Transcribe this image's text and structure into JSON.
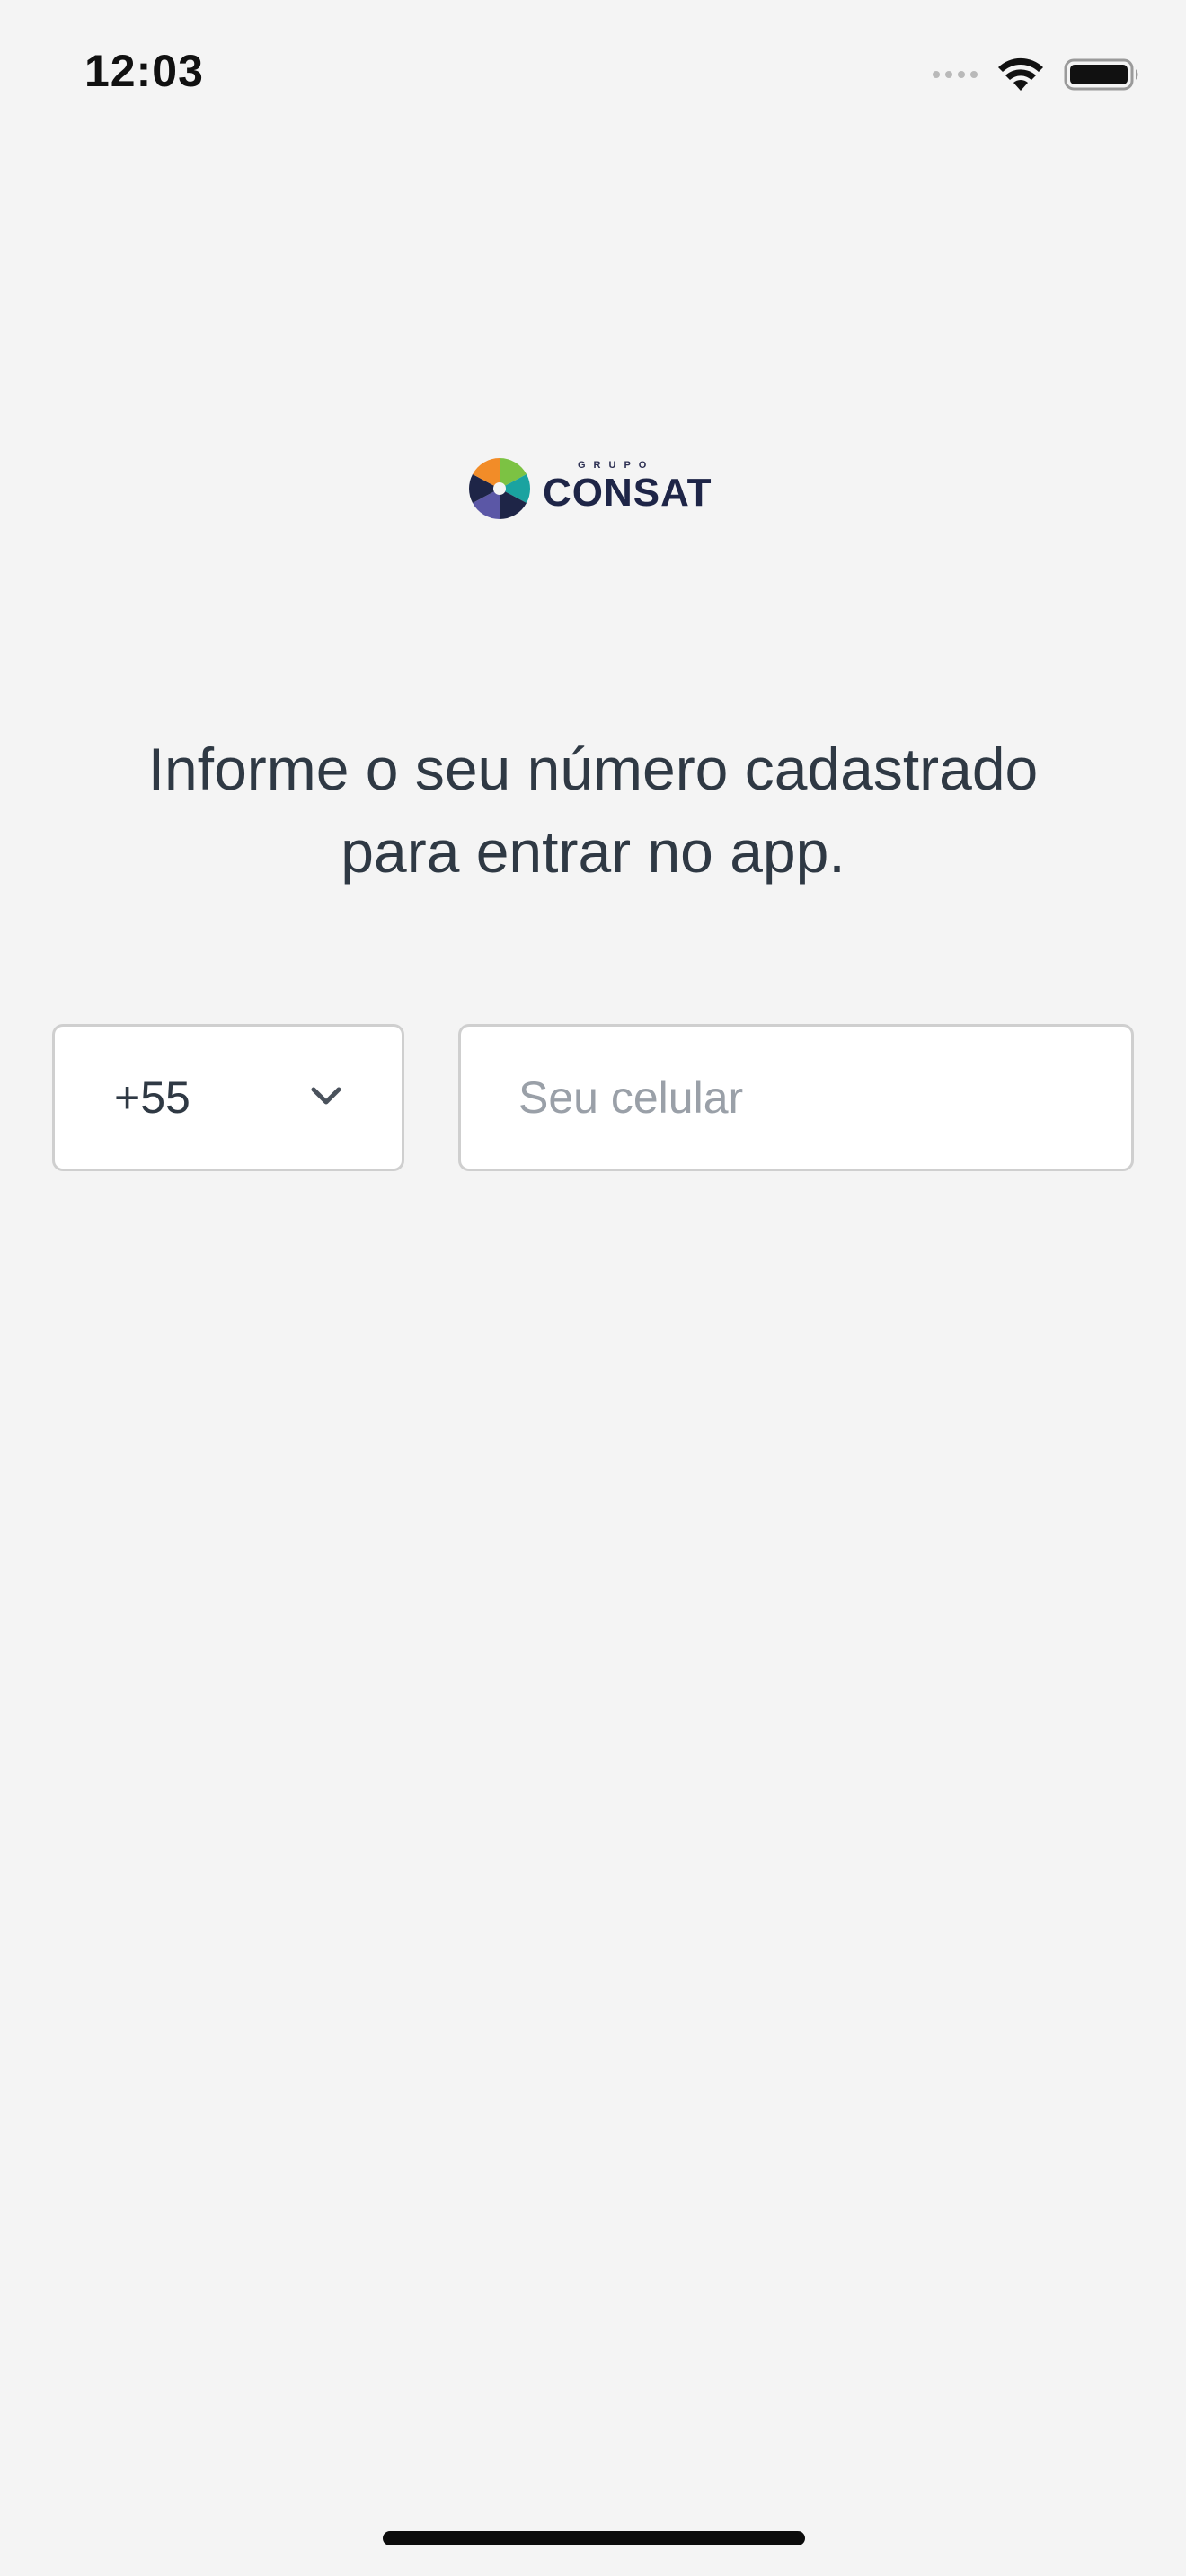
{
  "status_bar": {
    "time": "12:03",
    "icons": [
      "signal-icon",
      "wifi-icon",
      "battery-icon"
    ]
  },
  "logo": {
    "subtitle": "GRUPO",
    "name": "CONSAT",
    "colors": {
      "orange": "#f28c28",
      "green": "#7cc243",
      "teal": "#1aa3a0",
      "navy": "#1e2547",
      "purple": "#5b57a6"
    }
  },
  "instruction": {
    "line1": "Informe o seu número cadastrado",
    "line2": "para entrar no app."
  },
  "form": {
    "country_code": "+55",
    "phone_value": "",
    "phone_placeholder": "Seu celular"
  },
  "colors": {
    "background": "#f4f4f4",
    "field_border": "#cfcfcf",
    "text": "#2f3944",
    "placeholder": "#9aa0a8"
  }
}
